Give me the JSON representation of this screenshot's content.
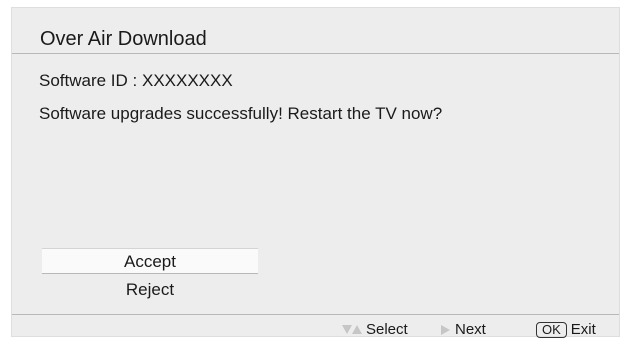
{
  "dialog": {
    "title": "Over Air Download",
    "software_id": "Software ID : XXXXXXXX",
    "message": "Software upgrades successfully! Restart the TV now?"
  },
  "options": {
    "selected": "Accept",
    "accept": "Accept",
    "reject": "Reject"
  },
  "footer": {
    "select_label": "Select",
    "select_icon": "up-down-arrow-icon",
    "next_label": "Next",
    "next_icon": "right-arrow-icon",
    "ok_key": "OK",
    "exit_label": "Exit"
  },
  "colors": {
    "panel_background": "#ededed",
    "selected_background": "#fafafa",
    "hint_arrows": "#c6c6c6"
  }
}
